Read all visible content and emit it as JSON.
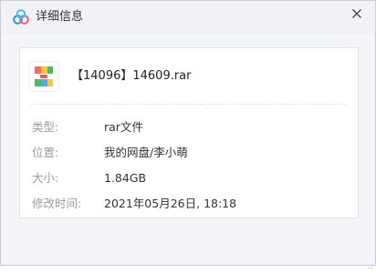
{
  "window": {
    "title": "详细信息",
    "close_label": "×"
  },
  "file": {
    "name": "【14096】14609.rar",
    "icon": "rar-archive-icon"
  },
  "details": [
    {
      "label": "类型:",
      "value": "rar文件"
    },
    {
      "label": "位置:",
      "value": "我的网盘/李小萌"
    },
    {
      "label": "大小:",
      "value": "1.84GB"
    },
    {
      "label": "修改时间:",
      "value": "2021年05月26日, 18:18"
    }
  ],
  "colors": {
    "titlebar_bg": "#f1f2f6",
    "label_text": "#999ca3",
    "value_text": "#333333"
  }
}
